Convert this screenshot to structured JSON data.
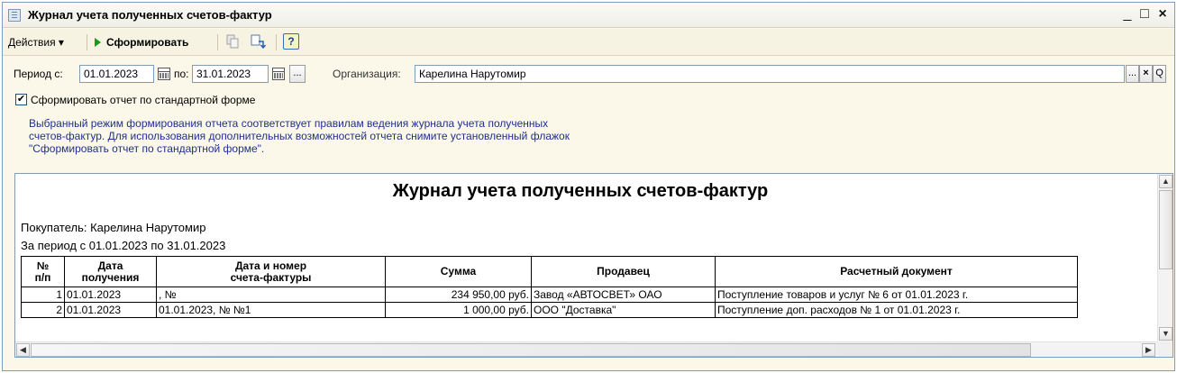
{
  "window": {
    "title": "Журнал учета полученных счетов-фактур",
    "minimize": "_",
    "maximize": "□",
    "close": "×"
  },
  "toolbar": {
    "actions_label": "Действия ▾",
    "generate_label": "Сформировать",
    "help_label": "?"
  },
  "form": {
    "period_from_label": "Период с:",
    "period_from_value": "01.01.2023",
    "period_to_label": "по:",
    "period_to_value": "31.01.2023",
    "period_select_label": "...",
    "organization_label": "Организация:",
    "organization_value": "Карелина Нарутомир",
    "org_select_label": "...",
    "org_clear_label": "×",
    "org_open_label": "Q",
    "standard_form_checked": true,
    "standard_form_label": "Сформировать отчет по стандартной форме",
    "info_lines": [
      "Выбранный режим формирования отчета соответствует правилам ведения журнала учета полученных",
      "счетов-фактур. Для использования дополнительных возможностей отчета снимите установленный флажок",
      "\"Сформировать отчет по стандартной форме\"."
    ]
  },
  "report": {
    "title": "Журнал учета полученных счетов-фактур",
    "buyer_line": "Покупатель:  Карелина Нарутомир",
    "period_line": "За период с 01.01.2023 по 31.01.2023",
    "columns": [
      "№\nп/п",
      "Дата\nполучения",
      "Дата и номер\nсчета-фактуры",
      "Сумма",
      "Продавец",
      "Расчетный документ"
    ],
    "rows": [
      [
        "1",
        "01.01.2023",
        ", №",
        "234 950,00 руб.",
        "Завод «АВТОСВЕТ» ОАО",
        "Поступление товаров и услуг № 6 от 01.01.2023 г."
      ],
      [
        "2",
        "01.01.2023",
        "01.01.2023, № №1",
        "1 000,00 руб.",
        "ООО \"Доставка\"",
        "Поступление доп. расходов № 1 от 01.01.2023 г."
      ]
    ]
  },
  "colors": {
    "window_bg": "#fbf8ea",
    "info_text": "#1f2f8f",
    "border": "#7f9db9"
  }
}
